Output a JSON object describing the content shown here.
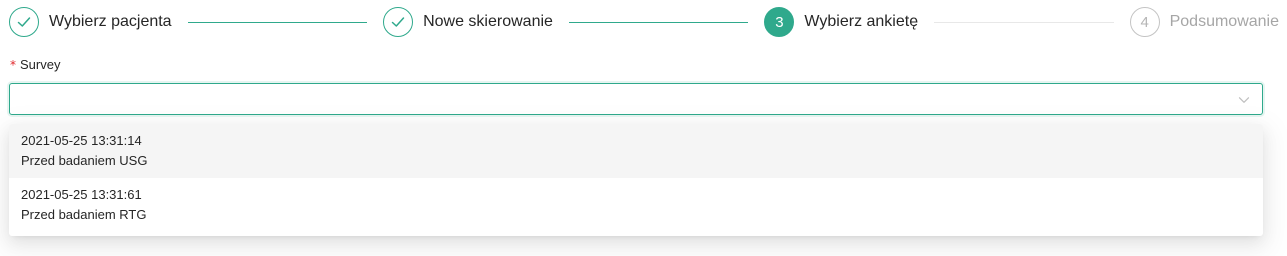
{
  "steps": [
    {
      "number": "1",
      "title": "Wybierz pacjenta",
      "status": "finish"
    },
    {
      "number": "2",
      "title": "Nowe skierowanie",
      "status": "finish"
    },
    {
      "number": "3",
      "title": "Wybierz ankietę",
      "status": "process"
    },
    {
      "number": "4",
      "title": "Podsumowanie",
      "status": "wait"
    }
  ],
  "form": {
    "required_mark": "*",
    "survey_label": "Survey",
    "survey_value": ""
  },
  "dropdown": {
    "options": [
      {
        "date": "2021-05-25 13:31:14",
        "name": "Przed badaniem USG"
      },
      {
        "date": "2021-05-25 13:31:61",
        "name": "Przed badaniem RTG"
      }
    ]
  },
  "colors": {
    "accent": "#2fa98c",
    "required": "#e0262b",
    "wait": "#c4c4c4"
  }
}
